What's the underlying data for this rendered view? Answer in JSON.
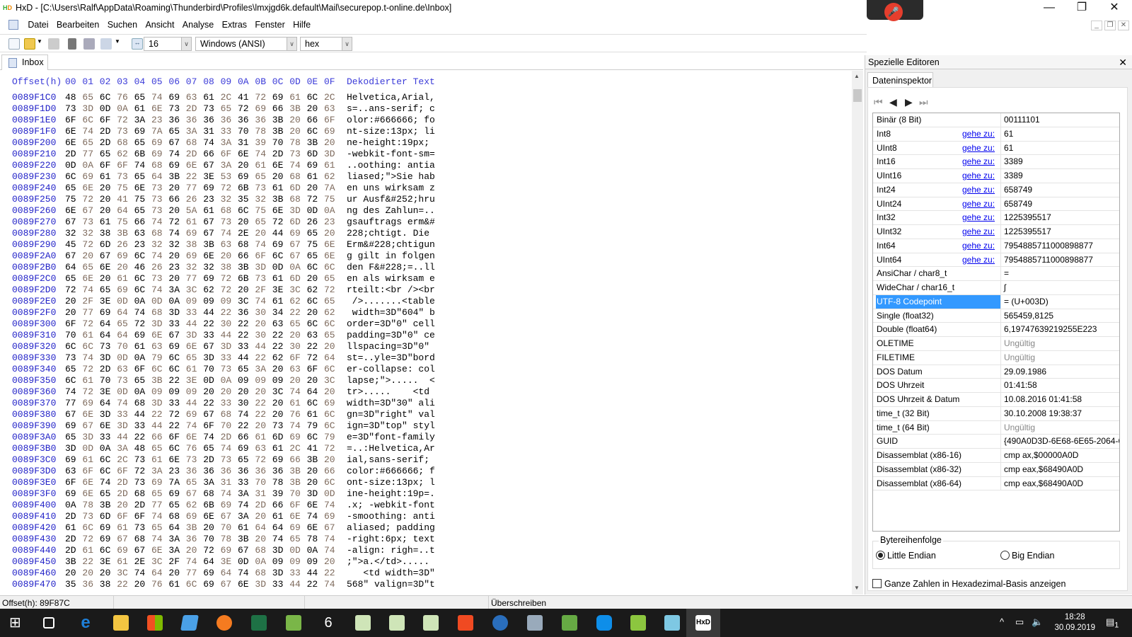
{
  "window": {
    "title": "HxD - [C:\\Users\\Ralf\\AppData\\Roaming\\Thunderbird\\Profiles\\lmxjgd6k.default\\Mail\\securepop.t-online.de\\Inbox]",
    "app_icon_text": "HxD"
  },
  "menu": [
    "Datei",
    "Bearbeiten",
    "Suchen",
    "Ansicht",
    "Analyse",
    "Extras",
    "Fenster",
    "Hilfe"
  ],
  "toolbar": {
    "bytes_per_row": "16",
    "charset": "Windows (ANSI)",
    "offset_base": "hex"
  },
  "tab": {
    "label": "Inbox"
  },
  "hex": {
    "header": {
      "offset": "Offset(h)",
      "columns": [
        "00",
        "01",
        "02",
        "03",
        "04",
        "05",
        "06",
        "07",
        "08",
        "09",
        "0A",
        "0B",
        "0C",
        "0D",
        "0E",
        "0F"
      ],
      "text": "Dekodierter Text"
    },
    "rows": [
      {
        "offset": "0089F1C0",
        "hex": "48 65 6C 76 65 74 69 63 61 2C 41 72 69 61 6C 2C",
        "text": "Helvetica,Arial,"
      },
      {
        "offset": "0089F1D0",
        "hex": "73 3D 0D 0A 61 6E 73 2D 73 65 72 69 66 3B 20 63",
        "text": "s=..ans-serif; c"
      },
      {
        "offset": "0089F1E0",
        "hex": "6F 6C 6F 72 3A 23 36 36 36 36 36 36 3B 20 66 6F",
        "text": "olor:#666666; fo"
      },
      {
        "offset": "0089F1F0",
        "hex": "6E 74 2D 73 69 7A 65 3A 31 33 70 78 3B 20 6C 69",
        "text": "nt-size:13px; li"
      },
      {
        "offset": "0089F200",
        "hex": "6E 65 2D 68 65 69 67 68 74 3A 31 39 70 78 3B 20",
        "text": "ne-height:19px; "
      },
      {
        "offset": "0089F210",
        "hex": "2D 77 65 62 6B 69 74 2D 66 6F 6E 74 2D 73 6D 3D",
        "text": "-webkit-font-sm="
      },
      {
        "offset": "0089F220",
        "hex": "0D 0A 6F 6F 74 68 69 6E 67 3A 20 61 6E 74 69 61",
        "text": "..oothing: antia"
      },
      {
        "offset": "0089F230",
        "hex": "6C 69 61 73 65 64 3B 22 3E 53 69 65 20 68 61 62",
        "text": "liased;\">Sie hab"
      },
      {
        "offset": "0089F240",
        "hex": "65 6E 20 75 6E 73 20 77 69 72 6B 73 61 6D 20 7A",
        "text": "en uns wirksam z"
      },
      {
        "offset": "0089F250",
        "hex": "75 72 20 41 75 73 66 26 23 32 35 32 3B 68 72 75",
        "text": "ur Ausf&#252;hru"
      },
      {
        "offset": "0089F260",
        "hex": "6E 67 20 64 65 73 20 5A 61 68 6C 75 6E 3D 0D 0A",
        "text": "ng des Zahlun=.."
      },
      {
        "offset": "0089F270",
        "hex": "67 73 61 75 66 74 72 61 67 73 20 65 72 6D 26 23",
        "text": "gsauftrags erm&#"
      },
      {
        "offset": "0089F280",
        "hex": "32 32 38 3B 63 68 74 69 67 74 2E 20 44 69 65 20",
        "text": "228;chtigt. Die "
      },
      {
        "offset": "0089F290",
        "hex": "45 72 6D 26 23 32 32 38 3B 63 68 74 69 67 75 6E",
        "text": "Erm&#228;chtigun"
      },
      {
        "offset": "0089F2A0",
        "hex": "67 20 67 69 6C 74 20 69 6E 20 66 6F 6C 67 65 6E",
        "text": "g gilt in folgen"
      },
      {
        "offset": "0089F2B0",
        "hex": "64 65 6E 20 46 26 23 32 32 38 3B 3D 0D 0A 6C 6C",
        "text": "den F&#228;=..ll"
      },
      {
        "offset": "0089F2C0",
        "hex": "65 6E 20 61 6C 73 20 77 69 72 6B 73 61 6D 20 65",
        "text": "en als wirksam e"
      },
      {
        "offset": "0089F2D0",
        "hex": "72 74 65 69 6C 74 3A 3C 62 72 20 2F 3E 3C 62 72",
        "text": "rteilt:<br /><br"
      },
      {
        "offset": "0089F2E0",
        "hex": "20 2F 3E 0D 0A 0D 0A 09 09 09 3C 74 61 62 6C 65",
        "text": " />.......<table"
      },
      {
        "offset": "0089F2F0",
        "hex": "20 77 69 64 74 68 3D 33 44 22 36 30 34 22 20 62",
        "text": " width=3D\"604\" b"
      },
      {
        "offset": "0089F300",
        "hex": "6F 72 64 65 72 3D 33 44 22 30 22 20 63 65 6C 6C",
        "text": "order=3D\"0\" cell"
      },
      {
        "offset": "0089F310",
        "hex": "70 61 64 64 69 6E 67 3D 33 44 22 30 22 20 63 65",
        "text": "padding=3D\"0\" ce"
      },
      {
        "offset": "0089F320",
        "hex": "6C 6C 73 70 61 63 69 6E 67 3D 33 44 22 30 22 20",
        "text": "llspacing=3D\"0\" "
      },
      {
        "offset": "0089F330",
        "hex": "73 74 3D 0D 0A 79 6C 65 3D 33 44 22 62 6F 72 64",
        "text": "st=..yle=3D\"bord"
      },
      {
        "offset": "0089F340",
        "hex": "65 72 2D 63 6F 6C 6C 61 70 73 65 3A 20 63 6F 6C",
        "text": "er-collapse: col"
      },
      {
        "offset": "0089F350",
        "hex": "6C 61 70 73 65 3B 22 3E 0D 0A 09 09 09 20 20 3C",
        "text": "lapse;\">.....  <"
      },
      {
        "offset": "0089F360",
        "hex": "74 72 3E 0D 0A 09 09 09 20 20 20 20 3C 74 64 20",
        "text": "tr>.....    <td "
      },
      {
        "offset": "0089F370",
        "hex": "77 69 64 74 68 3D 33 44 22 33 30 22 20 61 6C 69",
        "text": "width=3D\"30\" ali"
      },
      {
        "offset": "0089F380",
        "hex": "67 6E 3D 33 44 22 72 69 67 68 74 22 20 76 61 6C",
        "text": "gn=3D\"right\" val"
      },
      {
        "offset": "0089F390",
        "hex": "69 67 6E 3D 33 44 22 74 6F 70 22 20 73 74 79 6C",
        "text": "ign=3D\"top\" styl"
      },
      {
        "offset": "0089F3A0",
        "hex": "65 3D 33 44 22 66 6F 6E 74 2D 66 61 6D 69 6C 79",
        "text": "e=3D\"font-family"
      },
      {
        "offset": "0089F3B0",
        "hex": "3D 0D 0A 3A 48 65 6C 76 65 74 69 63 61 2C 41 72",
        "text": "=..:Helvetica,Ar"
      },
      {
        "offset": "0089F3C0",
        "hex": "69 61 6C 2C 73 61 6E 73 2D 73 65 72 69 66 3B 20",
        "text": "ial,sans-serif; "
      },
      {
        "offset": "0089F3D0",
        "hex": "63 6F 6C 6F 72 3A 23 36 36 36 36 36 36 3B 20 66",
        "text": "color:#666666; f"
      },
      {
        "offset": "0089F3E0",
        "hex": "6F 6E 74 2D 73 69 7A 65 3A 31 33 70 78 3B 20 6C",
        "text": "ont-size:13px; l"
      },
      {
        "offset": "0089F3F0",
        "hex": "69 6E 65 2D 68 65 69 67 68 74 3A 31 39 70 3D 0D",
        "text": "ine-height:19p=."
      },
      {
        "offset": "0089F400",
        "hex": "0A 78 3B 20 2D 77 65 62 6B 69 74 2D 66 6F 6E 74",
        "text": ".x; -webkit-font"
      },
      {
        "offset": "0089F410",
        "hex": "2D 73 6D 6F 6F 74 68 69 6E 67 3A 20 61 6E 74 69",
        "text": "-smoothing: anti"
      },
      {
        "offset": "0089F420",
        "hex": "61 6C 69 61 73 65 64 3B 20 70 61 64 64 69 6E 67",
        "text": "aliased; padding"
      },
      {
        "offset": "0089F430",
        "hex": "2D 72 69 67 68 74 3A 36 70 78 3B 20 74 65 78 74",
        "text": "-right:6px; text"
      },
      {
        "offset": "0089F440",
        "hex": "2D 61 6C 69 67 6E 3A 20 72 69 67 68 3D 0D 0A 74",
        "text": "-align: righ=..t"
      },
      {
        "offset": "0089F450",
        "hex": "3B 22 3E 61 2E 3C 2F 74 64 3E 0D 0A 09 09 09 20",
        "text": ";\">a.</td>..... "
      },
      {
        "offset": "0089F460",
        "hex": "20 20 20 3C 74 64 20 77 69 64 74 68 3D 33 44 22",
        "text": "   <td width=3D\""
      },
      {
        "offset": "0089F470",
        "hex": "35 36 38 22 20 76 61 6C 69 67 6E 3D 33 44 22 74",
        "text": "568\" valign=3D\"t"
      }
    ]
  },
  "inspector": {
    "panel_title": "Spezielle Editoren",
    "tab": "Dateninspektor",
    "goto_label": "gehe zu:",
    "rows": [
      {
        "label": "Binär (8 Bit)",
        "value": "00111101",
        "goto": false
      },
      {
        "label": "Int8",
        "value": "61",
        "goto": true
      },
      {
        "label": "UInt8",
        "value": "61",
        "goto": true
      },
      {
        "label": "Int16",
        "value": "3389",
        "goto": true
      },
      {
        "label": "UInt16",
        "value": "3389",
        "goto": true
      },
      {
        "label": "Int24",
        "value": "658749",
        "goto": true
      },
      {
        "label": "UInt24",
        "value": "658749",
        "goto": true
      },
      {
        "label": "Int32",
        "value": "1225395517",
        "goto": true
      },
      {
        "label": "UInt32",
        "value": "1225395517",
        "goto": true
      },
      {
        "label": "Int64",
        "value": "7954885711000898877",
        "goto": true
      },
      {
        "label": "UInt64",
        "value": "7954885711000898877",
        "goto": true
      },
      {
        "label": "AnsiChar / char8_t",
        "value": "="
      },
      {
        "label": "WideChar / char16_t",
        "value": "ʃ"
      },
      {
        "label": "UTF-8 Codepoint",
        "value": "= (U+003D)",
        "selected": true
      },
      {
        "label": "Single (float32)",
        "value": "565459,8125"
      },
      {
        "label": "Double (float64)",
        "value": "6,19747639219255E223"
      },
      {
        "label": "OLETIME",
        "value": "Ungültig",
        "invalid": true
      },
      {
        "label": "FILETIME",
        "value": "Ungültig",
        "invalid": true
      },
      {
        "label": "DOS Datum",
        "value": "29.09.1986"
      },
      {
        "label": "DOS Uhrzeit",
        "value": "01:41:58"
      },
      {
        "label": "DOS Uhrzeit & Datum",
        "value": "10.08.2016 01:41:58"
      },
      {
        "label": "time_t (32 Bit)",
        "value": "30.10.2008 19:38:37"
      },
      {
        "label": "time_t (64 Bit)",
        "value": "Ungültig",
        "invalid": true
      },
      {
        "label": "GUID",
        "value": "{490A0D3D-6E68-6E65-2064-6965"
      },
      {
        "label": "Disassemblat (x86-16)",
        "value": "cmp ax,$00000A0D"
      },
      {
        "label": "Disassemblat (x86-32)",
        "value": "cmp eax,$68490A0D"
      },
      {
        "label": "Disassemblat (x86-64)",
        "value": "cmp eax,$68490A0D"
      }
    ],
    "byte_order_label": "Bytereihenfolge",
    "little_endian": "Little Endian",
    "big_endian": "Big Endian",
    "selected_order": "little",
    "hex_checkbox": "Ganze Zahlen in Hexadezimal-Basis anzeigen",
    "hex_checked": false
  },
  "status": {
    "offset": "Offset(h): 89F87C",
    "mode": "Überschreiben"
  },
  "taskbar": {
    "time": "18:28",
    "date": "30.09.2019",
    "notifications": "1"
  }
}
